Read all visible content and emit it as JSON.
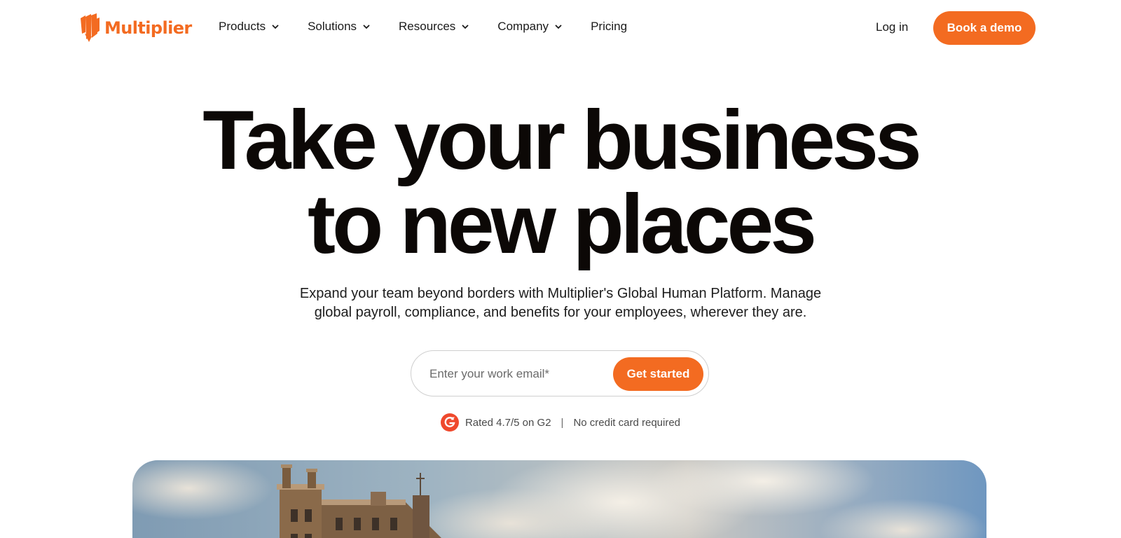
{
  "brand": {
    "name": "Multiplier",
    "accent": "#f36b21"
  },
  "nav": {
    "items": [
      {
        "label": "Products",
        "icon": "chevron-down-icon"
      },
      {
        "label": "Solutions",
        "icon": "chevron-down-icon"
      },
      {
        "label": "Resources",
        "icon": "chevron-down-icon"
      },
      {
        "label": "Company",
        "icon": "chevron-down-icon"
      },
      {
        "label": "Pricing"
      }
    ],
    "login_label": "Log in",
    "demo_label": "Book a demo"
  },
  "hero": {
    "headline_line1": "Take your business",
    "headline_line2": "to new places",
    "subhead_line1": "Expand your team beyond borders with Multiplier's Global Human Platform. Manage",
    "subhead_line2": "global payroll, compliance, and benefits for your employees, wherever they are.",
    "email_placeholder": "Enter your work email*",
    "cta_label": "Get started"
  },
  "trust": {
    "g2_icon": "g2-logo-icon",
    "rating_text": "Rated 4.7/5 on G2",
    "separator": "|",
    "note": "No credit card required"
  },
  "hero_image": {
    "subject": "building-and-sky-photo"
  }
}
